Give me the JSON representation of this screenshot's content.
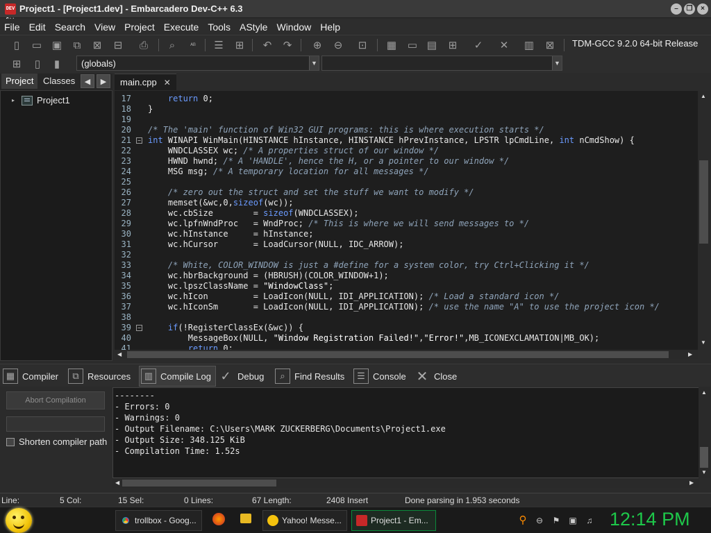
{
  "window": {
    "title": "Project1 - [Project1.dev] - Embarcadero Dev-C++ 6.3",
    "app_icon_text": "DEV C++"
  },
  "menu": [
    "File",
    "Edit",
    "Search",
    "View",
    "Project",
    "Execute",
    "Tools",
    "AStyle",
    "Window",
    "Help"
  ],
  "toolbar": {
    "compiler": "TDM-GCC 9.2.0 64-bit Release",
    "scope_combo": "(globals)"
  },
  "left_panel": {
    "tabs": [
      "Project",
      "Classes"
    ],
    "tree_root": "Project1"
  },
  "editor": {
    "tab_label": "main.cpp",
    "lines": [
      {
        "n": "17",
        "html": "    <span class=\"kw\">return</span> 0;"
      },
      {
        "n": "18",
        "html": "}"
      },
      {
        "n": "19",
        "html": ""
      },
      {
        "n": "20",
        "html": "<span class=\"cm\">/* The 'main' function of Win32 GUI programs: this is where execution starts */</span>"
      },
      {
        "n": "21",
        "html": "<span class=\"kw\">int</span> WINAPI WinMain(HINSTANCE hInstance, HINSTANCE hPrevInstance, LPSTR lpCmdLine, <span class=\"kw\">int</span> nCmdShow) {",
        "fold": "−"
      },
      {
        "n": "22",
        "html": "    WNDCLASSEX wc; <span class=\"cm\">/* A properties struct of our window */</span>"
      },
      {
        "n": "23",
        "html": "    HWND hwnd; <span class=\"cm\">/* A 'HANDLE', hence the H, or a pointer to our window */</span>"
      },
      {
        "n": "24",
        "html": "    MSG msg; <span class=\"cm\">/* A temporary location for all messages */</span>"
      },
      {
        "n": "25",
        "html": ""
      },
      {
        "n": "26",
        "html": "    <span class=\"cm\">/* zero out the struct and set the stuff we want to modify */</span>"
      },
      {
        "n": "27",
        "html": "    memset(&amp;wc,0,<span class=\"kw\">sizeof</span>(wc));"
      },
      {
        "n": "28",
        "html": "    wc.cbSize        = <span class=\"kw\">sizeof</span>(WNDCLASSEX);"
      },
      {
        "n": "29",
        "html": "    wc.lpfnWndProc   = WndProc; <span class=\"cm\">/* This is where we will send messages to */</span>"
      },
      {
        "n": "30",
        "html": "    wc.hInstance     = hInstance;"
      },
      {
        "n": "31",
        "html": "    wc.hCursor       = LoadCursor(NULL, IDC_ARROW);"
      },
      {
        "n": "32",
        "html": ""
      },
      {
        "n": "33",
        "html": "    <span class=\"cm\">/* White, COLOR_WINDOW is just a #define for a system color, try Ctrl+Clicking it */</span>"
      },
      {
        "n": "34",
        "html": "    wc.hbrBackground = (HBRUSH)(COLOR_WINDOW+1);"
      },
      {
        "n": "35",
        "html": "    wc.lpszClassName = <span class=\"str\">\"WindowClass\"</span>;"
      },
      {
        "n": "36",
        "html": "    wc.hIcon         = LoadIcon(NULL, IDI_APPLICATION); <span class=\"cm\">/* Load a standard icon */</span>"
      },
      {
        "n": "37",
        "html": "    wc.hIconSm       = LoadIcon(NULL, IDI_APPLICATION); <span class=\"cm\">/* use the name \"A\" to use the project icon */</span>"
      },
      {
        "n": "38",
        "html": ""
      },
      {
        "n": "39",
        "html": "    <span class=\"kw\">if</span>(!RegisterClassEx(&amp;wc)) {",
        "fold": "−"
      },
      {
        "n": "40",
        "html": "        MessageBox(NULL, <span class=\"str\">\"Window Registration Failed!\"</span>,<span class=\"str\">\"Error!\"</span>,MB_ICONEXCLAMATION|MB_OK);"
      },
      {
        "n": "41",
        "html": "        <span class=\"kw\">return</span> 0;"
      }
    ]
  },
  "bottom_tabs": [
    "Compiler",
    "Resources",
    "Compile Log",
    "Debug",
    "Find Results",
    "Console",
    "Close"
  ],
  "compile_panel": {
    "abort_label": "Abort Compilation",
    "shorten_label": "Shorten compiler path"
  },
  "compile_log": [
    "--------",
    "- Errors: 0",
    "- Warnings: 0",
    "- Output Filename: C:\\Users\\MARK ZUCKERBERG\\Documents\\Project1.exe",
    "- Output Size: 348.125 KiB",
    "- Compilation Time: 1.52s"
  ],
  "status": {
    "line_label": "Line:",
    "col": "5 Col:",
    "sel": "15 Sel:",
    "lines": "0 Lines:",
    "length": "67 Length:",
    "insert": "2408 Insert",
    "message": "Done parsing in 1.953 seconds"
  },
  "taskbar": {
    "items": [
      "trollbox - Goog...",
      "Yahoo! Messe...",
      "Project1 - Em..."
    ],
    "clock": "12:14 PM"
  },
  "colors": {
    "keyword": "#6b9bff",
    "comment": "#8fa4ba",
    "clock": "#1ec84a"
  }
}
